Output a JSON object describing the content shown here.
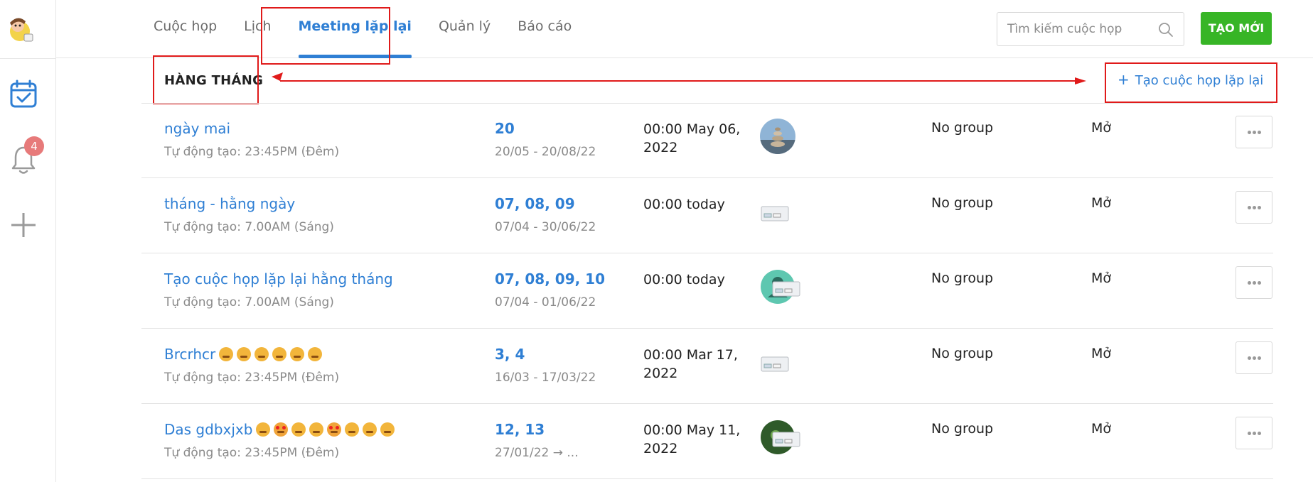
{
  "nav": {
    "tabs": [
      {
        "label": "Cuộc họp"
      },
      {
        "label": "Lịch"
      },
      {
        "label": "Meeting lặp lại"
      },
      {
        "label": "Quản lý"
      },
      {
        "label": "Báo cáo"
      }
    ],
    "active_tab": "Meeting lặp lại",
    "search_placeholder": "Tìm kiếm cuộc họp",
    "create_button": "TẠO MỚI"
  },
  "sidebar": {
    "notification_count": "4",
    "icons": [
      "app-logo",
      "calendar-check-icon",
      "bell-icon",
      "plus-icon"
    ]
  },
  "section": {
    "title": "HÀNG THÁNG",
    "add_label": "Tạo cuộc họp lặp lại",
    "add_glyph": "+"
  },
  "rows": [
    {
      "name": "ngày mai",
      "emojis": [],
      "auto": "Tự động tạo: 23:45PM (Đêm)",
      "days": "20",
      "range": "20/05 - 20/08/22",
      "time": "00:00 May 06, 2022",
      "avatar": "photo",
      "group": "No group",
      "status": "Mở"
    },
    {
      "name": "tháng - hằng ngày",
      "emojis": [],
      "auto": "Tự động tạo: 7.00AM (Sáng)",
      "days": "07, 08, 09",
      "range": "07/04 - 30/06/22",
      "time": "00:00 today",
      "avatar": "dialog",
      "group": "No group",
      "status": "Mở"
    },
    {
      "name": "Tạo cuộc họp lặp lại hằng tháng",
      "emojis": [],
      "auto": "Tự động tạo: 7.00AM (Sáng)",
      "days": "07, 08, 09, 10",
      "range": "07/04 - 01/06/22",
      "time": "00:00 today",
      "avatar": "user-dialog",
      "group": "No group",
      "status": "Mở"
    },
    {
      "name": "Brcrhcr",
      "emojis": [
        "sad-face",
        "sad-face",
        "crying-face",
        "sad-face",
        "sad-face",
        "sad-face"
      ],
      "auto": "Tự động tạo: 23:45PM (Đêm)",
      "days": "3, 4",
      "range": "16/03 - 17/03/22",
      "time": "00:00 Mar 17, 2022",
      "avatar": "dialog",
      "group": "No group",
      "status": "Mở"
    },
    {
      "name": "Das gdbxjxb",
      "emojis": [
        "grin-face",
        "heart-eyes-face",
        "kiss-face",
        "grin-face",
        "love-face",
        "grin-face",
        "kiss-face",
        "grin-face"
      ],
      "auto": "Tự động tạo: 23:45PM (Đêm)",
      "days": "12, 13",
      "range": "27/01/22 → ...",
      "time": "00:00 May 11, 2022",
      "avatar": "photo-dialog",
      "group": "No group",
      "status": "Mở"
    }
  ],
  "colors": {
    "accent": "#2f7fd4",
    "create_button": "#37b526",
    "annotation": "#e01a1a",
    "badge": "#e77a7a"
  }
}
